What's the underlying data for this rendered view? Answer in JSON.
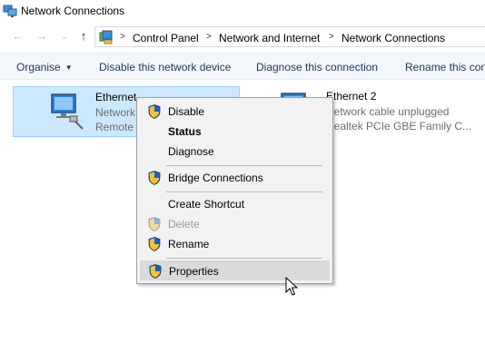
{
  "window": {
    "title": "Network Connections"
  },
  "address": {
    "breadcrumbs": [
      "Control Panel",
      "Network and Internet",
      "Network Connections"
    ]
  },
  "commands": {
    "organise": "Organise",
    "disable": "Disable this network device",
    "diagnose": "Diagnose this connection",
    "rename": "Rename this con"
  },
  "adapters": [
    {
      "name": "Ethernet",
      "line1": "Network",
      "line2": "Remote"
    },
    {
      "name": "Ethernet 2",
      "line1": "Network cable unplugged",
      "line2": "Realtek PCIe GBE Family C..."
    }
  ],
  "context_menu": {
    "items": [
      {
        "label": "Disable",
        "icon": "shield-icon"
      },
      {
        "label": "Status",
        "bold": true
      },
      {
        "label": "Diagnose"
      },
      {
        "label": "Bridge Connections",
        "icon": "shield-icon"
      },
      {
        "label": "Create Shortcut"
      },
      {
        "label": "Delete",
        "icon": "shield-icon",
        "disabled": true
      },
      {
        "label": "Rename",
        "icon": "shield-icon"
      },
      {
        "label": "Properties",
        "icon": "shield-icon",
        "highlighted": true
      }
    ]
  },
  "colors": {
    "selection_bg": "#cce8ff",
    "command_text": "#1e395b",
    "menu_bg": "#f2f2f2",
    "menu_hover": "#dadada"
  }
}
